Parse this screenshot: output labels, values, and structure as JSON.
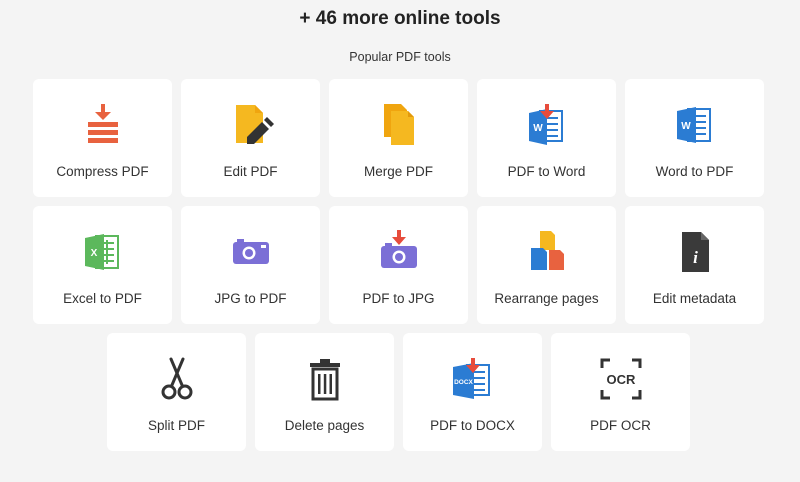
{
  "headline": "+ 46 more online tools",
  "subhead": "Popular PDF tools",
  "tools": [
    {
      "label": "Compress PDF",
      "icon": "compress-icon"
    },
    {
      "label": "Edit PDF",
      "icon": "edit-pdf-icon"
    },
    {
      "label": "Merge PDF",
      "icon": "merge-icon"
    },
    {
      "label": "PDF to Word",
      "icon": "pdf-to-word-icon"
    },
    {
      "label": "Word to PDF",
      "icon": "word-icon"
    },
    {
      "label": "Excel to PDF",
      "icon": "excel-icon"
    },
    {
      "label": "JPG to PDF",
      "icon": "camera-icon"
    },
    {
      "label": "PDF to JPG",
      "icon": "pdf-to-jpg-icon"
    },
    {
      "label": "Rearrange pages",
      "icon": "rearrange-icon"
    },
    {
      "label": "Edit metadata",
      "icon": "metadata-icon"
    },
    {
      "label": "Split PDF",
      "icon": "scissors-icon"
    },
    {
      "label": "Delete pages",
      "icon": "trash-icon"
    },
    {
      "label": "PDF to DOCX",
      "icon": "pdf-to-docx-icon"
    },
    {
      "label": "PDF OCR",
      "icon": "ocr-icon"
    }
  ],
  "icon_text": {
    "word": "W",
    "excel": "X",
    "docx": "DOCX",
    "ocr": "OCR",
    "info": "i"
  },
  "colors": {
    "orange_red": "#e8623f",
    "yellow": "#f5b820",
    "yellow_dark": "#f0a50f",
    "blue": "#2b7cd3",
    "green": "#5cb85c",
    "purple": "#7b6fd6",
    "dark": "#333333",
    "red": "#e74c3c"
  }
}
